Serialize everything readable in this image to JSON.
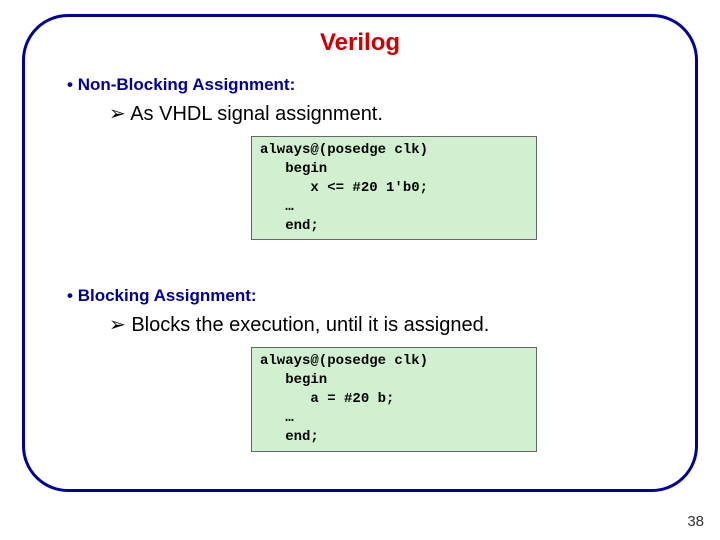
{
  "title": "Verilog",
  "sections": [
    {
      "heading": "Non-Blocking Assignment:",
      "sub": "As VHDL signal assignment.",
      "code": "always@(posedge clk)\n   begin\n      x <= #20 1'b0;\n   …\n   end;"
    },
    {
      "heading": "Blocking Assignment:",
      "sub": "Blocks the execution, until it is assigned.",
      "code": "always@(posedge clk)\n   begin\n      a = #20 b;\n   …\n   end;"
    }
  ],
  "page_number": "38"
}
